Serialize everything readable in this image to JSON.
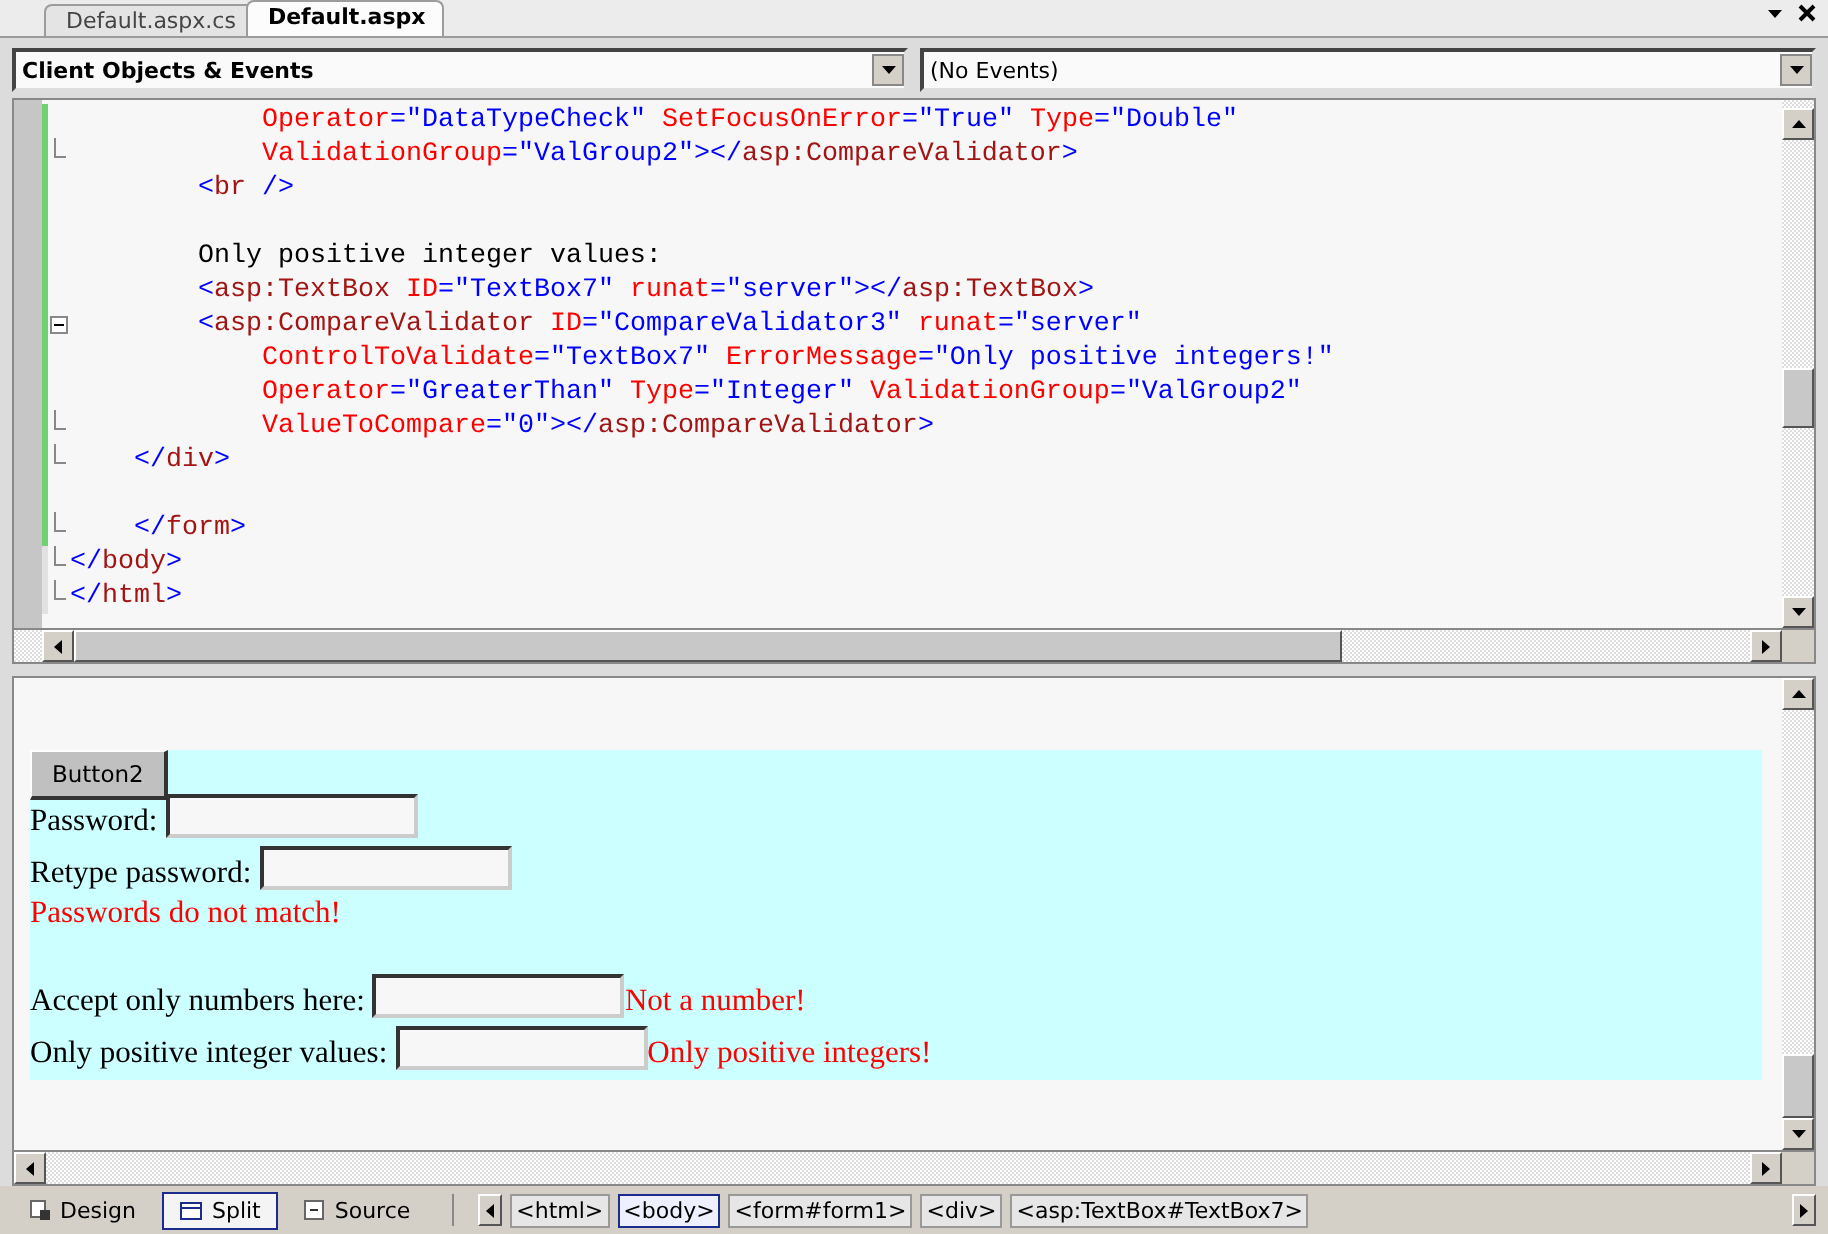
{
  "doc_tabs": [
    {
      "label": "Default.aspx.cs",
      "selected": false
    },
    {
      "label": "Default.aspx",
      "selected": true
    }
  ],
  "dropdowns": [
    {
      "value": "Client Objects & Events",
      "bold": true
    },
    {
      "value": "(No Events)",
      "bold": false
    }
  ],
  "code_lines": [
    {
      "kind": "code",
      "changed": true,
      "text": "            Operator=\"DataTypeCheck\" SetFocusOnError=\"True\" Type=\"Double\""
    },
    {
      "kind": "code",
      "changed": true,
      "block_end": true,
      "text": "            ValidationGroup=\"ValGroup2\"></asp:CompareValidator>"
    },
    {
      "kind": "code",
      "changed": true,
      "text": "        <br />"
    },
    {
      "kind": "blank",
      "changed": true
    },
    {
      "kind": "code",
      "changed": true,
      "text": "        Only positive integer values:"
    },
    {
      "kind": "code",
      "changed": true,
      "text": "        <asp:TextBox ID=\"TextBox7\" runat=\"server\"></asp:TextBox>"
    },
    {
      "kind": "code",
      "changed": true,
      "collapsible": true,
      "text": "        <asp:CompareValidator ID=\"CompareValidator3\" runat=\"server\""
    },
    {
      "kind": "code",
      "changed": true,
      "text": "            ControlToValidate=\"TextBox7\" ErrorMessage=\"Only positive integers!\""
    },
    {
      "kind": "code",
      "changed": true,
      "text": "            Operator=\"GreaterThan\" Type=\"Integer\" ValidationGroup=\"ValGroup2\""
    },
    {
      "kind": "code",
      "changed": true,
      "block_end": true,
      "text": "            ValueToCompare=\"0\"></asp:CompareValidator>"
    },
    {
      "kind": "code",
      "changed": true,
      "block_end": true,
      "text": "    </div>"
    },
    {
      "kind": "blank",
      "changed": true
    },
    {
      "kind": "code",
      "changed": true,
      "block_end": true,
      "text": "    </form>"
    },
    {
      "kind": "code",
      "changed": false,
      "block_end": true,
      "text": "</body>"
    },
    {
      "kind": "code",
      "changed": false,
      "block_end": true,
      "text": "</html>"
    }
  ],
  "design": {
    "button": "Button2",
    "rows": [
      {
        "kind": "field",
        "label": "Password:"
      },
      {
        "kind": "field",
        "label": "Retype password:"
      },
      {
        "kind": "error",
        "text": "Passwords do not match!"
      },
      {
        "kind": "gap"
      },
      {
        "kind": "field",
        "label": "Accept only numbers here:",
        "error": "Not a number!"
      },
      {
        "kind": "field",
        "label": "Only positive integer values:",
        "error": "Only positive integers!"
      }
    ]
  },
  "view_tabs": [
    {
      "kind": "design",
      "label": "Design",
      "selected": false
    },
    {
      "kind": "split",
      "label": "Split",
      "selected": true
    },
    {
      "kind": "source",
      "label": "Source",
      "selected": false
    }
  ],
  "breadcrumbs": [
    {
      "label": "<html>",
      "selected": false
    },
    {
      "label": "<body>",
      "selected": true
    },
    {
      "label": "<form#form1>",
      "selected": false
    },
    {
      "label": "<div>",
      "selected": false
    },
    {
      "label": "<asp:TextBox#TextBox7>",
      "selected": false
    }
  ]
}
